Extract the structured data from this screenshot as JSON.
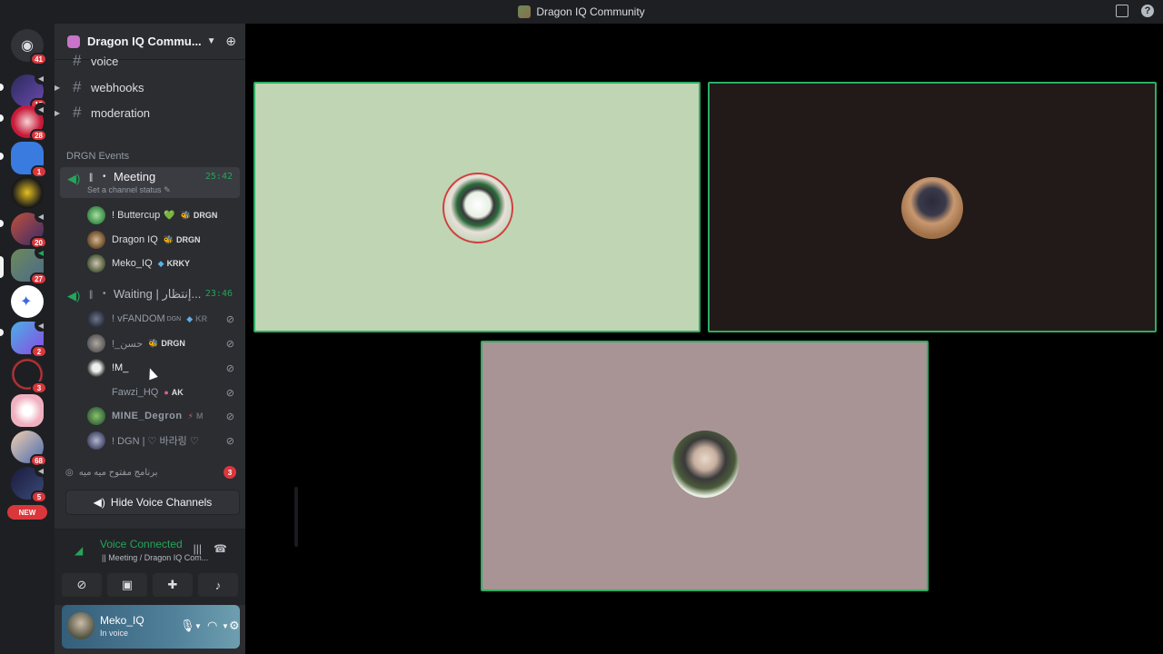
{
  "window": {
    "title": "Dragon IQ Community",
    "inbox_icon": "inbox-icon",
    "help_icon": "help-icon"
  },
  "rail": {
    "home_badge": "41",
    "servers": [
      {
        "badge": "18"
      },
      {
        "badge": "28"
      },
      {
        "badge": "1"
      },
      {
        "badge": ""
      },
      {
        "badge": "20"
      },
      {
        "badge": "27"
      },
      {
        "badge": ""
      },
      {
        "badge": "2"
      },
      {
        "badge": "3"
      },
      {
        "badge": ""
      },
      {
        "badge": "68"
      },
      {
        "badge": "5"
      }
    ],
    "new_label": "NEW"
  },
  "guild": {
    "name": "Dragon IQ Commu...",
    "channels": [
      {
        "name": "voice"
      },
      {
        "name": "webhooks"
      },
      {
        "name": "moderation"
      }
    ],
    "category": "DRGN Events",
    "voice_channels": [
      {
        "name": "Meeting",
        "time": "25:42",
        "status": "Set a channel status",
        "members": [
          {
            "name": "! Buttercup",
            "emoji": "💚",
            "tag": "DRGN"
          },
          {
            "name": "Dragon IQ",
            "tag": "DRGN"
          },
          {
            "name": "Meko_IQ",
            "tag": "KRKY"
          }
        ]
      },
      {
        "name": "Waiting | إنتظار...",
        "time": "23:46",
        "members": [
          {
            "name": "! vFANDOM",
            "sub": "DGN",
            "tag": "KR"
          },
          {
            "name": "!_حسن",
            "tag": "DRGN"
          },
          {
            "name": "!M_",
            "tag": ""
          },
          {
            "name": "Fawzi_HQ",
            "tag": "AK"
          },
          {
            "name": "MINE_Degron",
            "tag": "M"
          },
          {
            "name": "! DGN | ♡ 바라링 ♡",
            "tag": ""
          }
        ]
      }
    ],
    "stage_channel": {
      "name": "برنامج مفتوح ميه ميه",
      "count": "3"
    },
    "hide_voice_label": "Hide Voice Channels"
  },
  "voice_panel": {
    "status": "Voice Connected",
    "location": "Meeting / Dragon IQ Com..."
  },
  "user": {
    "name": "Meko_IQ",
    "status": "In voice"
  },
  "colors": {
    "accent_green": "#23a55a",
    "tile_border": "#2dad62",
    "badge_red": "#da373c"
  }
}
